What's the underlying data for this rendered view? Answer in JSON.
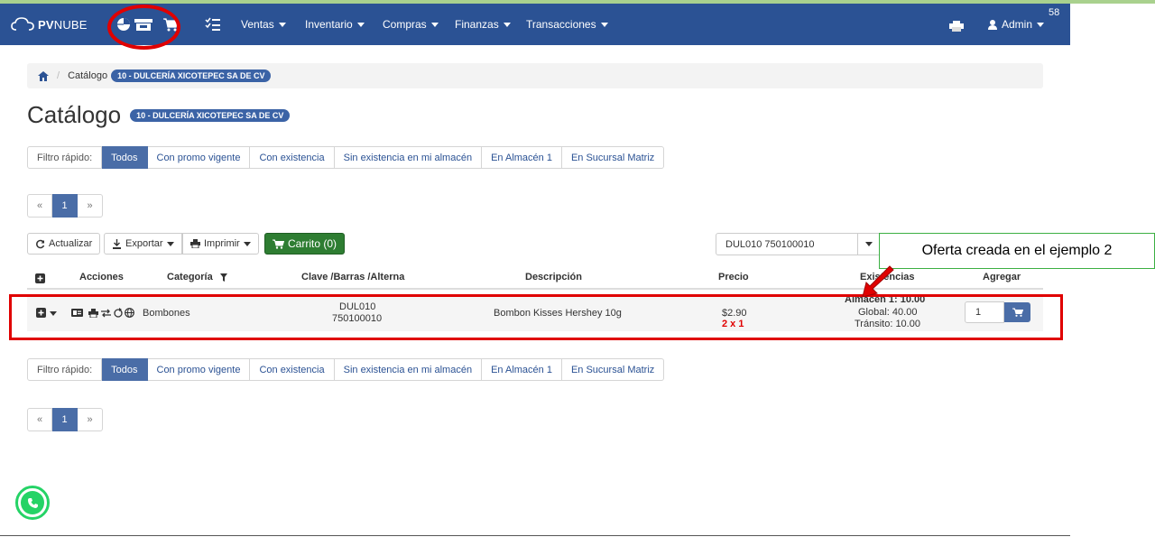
{
  "app": {
    "logo_text_bold": "PV",
    "logo_text_rest": "NUBE",
    "badge": "58"
  },
  "nav": {
    "menus": [
      {
        "label": "Ventas"
      },
      {
        "label": "Inventario"
      },
      {
        "label": "Compras"
      },
      {
        "label": "Finanzas"
      },
      {
        "label": "Transacciones"
      }
    ],
    "user": "Admin",
    "icons": [
      "pie-chart-icon",
      "store-icon",
      "cart-icon",
      "checklist-icon",
      "printer-icon",
      "user-icon"
    ]
  },
  "breadcrumb": {
    "label": "Catálogo",
    "company": "10 - DULCERÍA XICOTEPEC SA DE CV"
  },
  "page": {
    "title": "Catálogo",
    "company": "10 - DULCERÍA XICOTEPEC SA DE CV"
  },
  "filters": {
    "label": "Filtro rápido:",
    "options": [
      "Todos",
      "Con promo vigente",
      "Con existencia",
      "Sin existencia en mi almacén",
      "En Almacén 1",
      "En Sucursal Matriz"
    ],
    "active": "Todos"
  },
  "pager": {
    "prev": "«",
    "page": "1",
    "next": "»"
  },
  "toolbar": {
    "refresh": "Actualizar",
    "export": "Exportar",
    "print": "Imprimir",
    "cart": "Carrito (0)"
  },
  "search": {
    "value": "DUL010 750100010"
  },
  "table": {
    "headers": {
      "actions": "Acciones",
      "category": "Categoría",
      "code": "Clave /Barras /Alterna",
      "description": "Descripción",
      "price": "Precio",
      "stock": "Existencias",
      "add": "Agregar"
    },
    "rows": [
      {
        "category": "Bombones",
        "code": "DUL010",
        "barcode": "750100010",
        "description": "Bombon Kisses Hershey 10g",
        "price": "$2.90",
        "promo": "2 x 1",
        "stock_warehouse": "Almacén 1: 10.00",
        "stock_global": "Global: 40.00",
        "stock_transit": "Tránsito: 10.00",
        "qty": "1"
      }
    ]
  },
  "annotation": {
    "callout": "Oferta creada en el ejemplo 2"
  },
  "colors": {
    "navbar": "#2b5294",
    "accent": "#4a6da7",
    "annotation_red": "#e00000",
    "cart_green": "#2e7d32",
    "callout_border": "#3cb043"
  }
}
